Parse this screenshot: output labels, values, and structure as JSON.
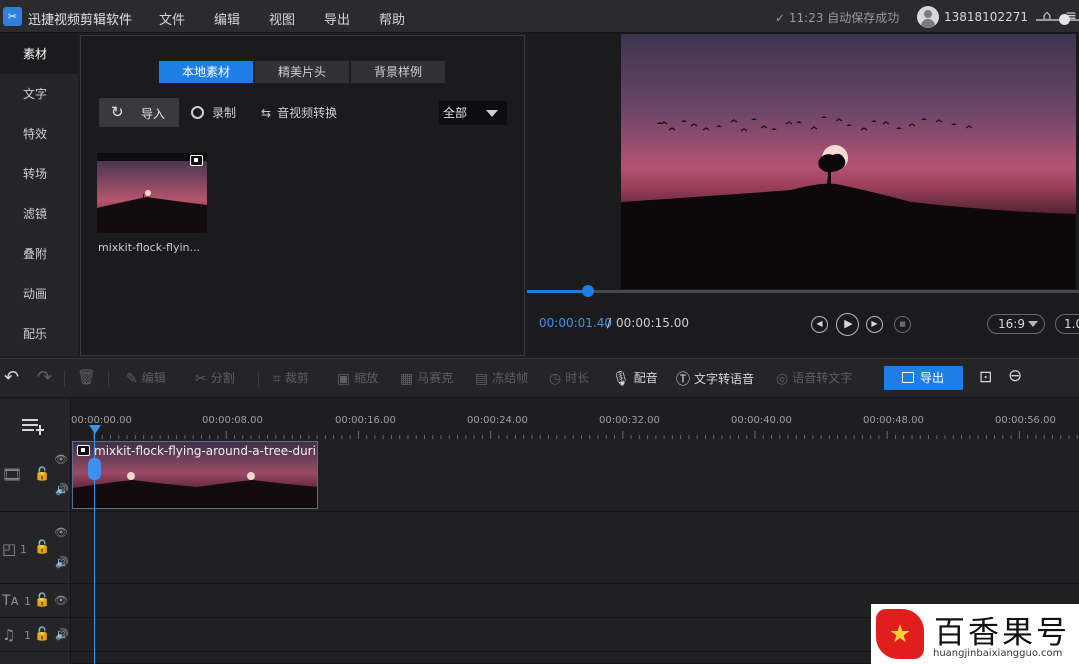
{
  "app": {
    "title": "迅捷视频剪辑软件",
    "logo_glyph": "✂"
  },
  "menu": [
    "文件",
    "编辑",
    "视图",
    "导出",
    "帮助"
  ],
  "status": {
    "save_text": "✓ 11:23 自动保存成功",
    "user_name": "13818102271",
    "home_icon": "⌂",
    "menu_icon": "≡"
  },
  "sidenav": [
    "素材",
    "文字",
    "特效",
    "转场",
    "滤镜",
    "叠附",
    "动画",
    "配乐"
  ],
  "media": {
    "tabs": [
      "本地素材",
      "精美片头",
      "背景样例"
    ],
    "import_label": "导入",
    "record_label": "录制",
    "convert_label": "音视频转换",
    "filter_value": "全部",
    "thumb_label": "mixkit-flock-flyin..."
  },
  "preview": {
    "time_current": "00:00:01.40",
    "time_sep": "/",
    "time_total": "00:00:15.00",
    "ratio": "16:9",
    "speed": "1.0",
    "progress": 0.11
  },
  "toolbar": {
    "edit": "编辑",
    "split": "分割",
    "crop": "裁剪",
    "zoom": "缩放",
    "mosaic": "马赛克",
    "freeze": "冻结帧",
    "duration": "时长",
    "dub": "配音",
    "tts": "文字转语音",
    "stt": "语音转文字",
    "export": "导出"
  },
  "timeline": {
    "ticks": [
      "00:00:00.00",
      "00:00:08.00",
      "00:00:16.00",
      "00:00:24.00",
      "00:00:32.00",
      "00:00:40.00",
      "00:00:48.00",
      "00:00:56.00"
    ],
    "clip_title": "mixkit-flock-flying-around-a-tree-duri...",
    "track_nums": [
      "1",
      "1",
      "1"
    ]
  },
  "watermark": {
    "title": "百香果号",
    "domain": "huangjinbaixiangguo.com"
  },
  "colors": {
    "accent": "#1d7fe6",
    "playhead": "#3d93ee"
  }
}
